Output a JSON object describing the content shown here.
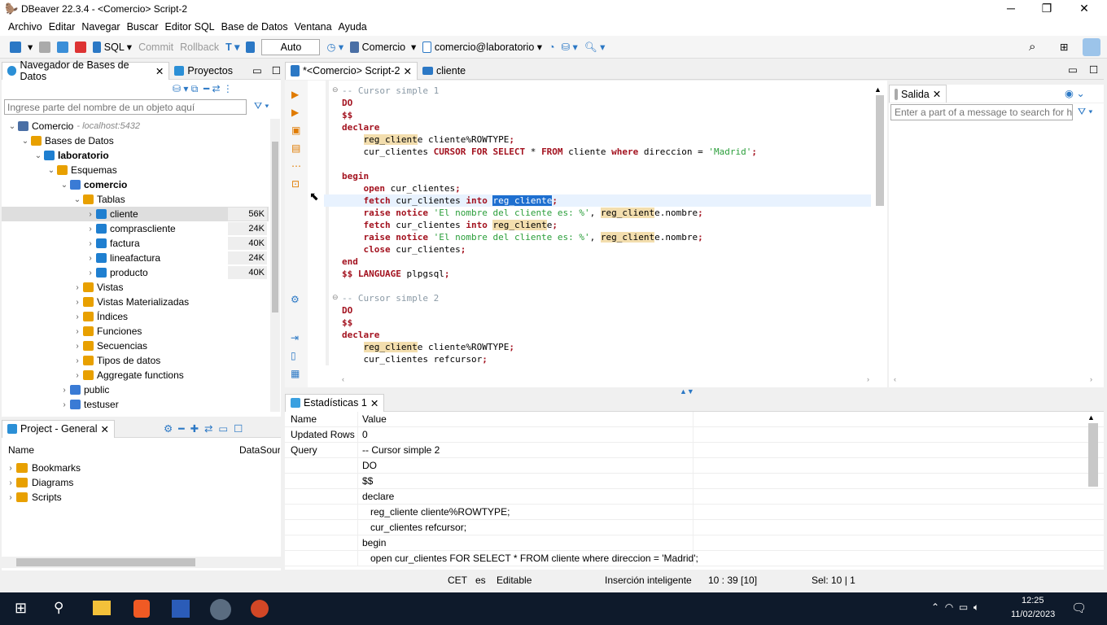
{
  "window": {
    "title": "DBeaver 22.3.4 - <Comercio> Script-2"
  },
  "menu": [
    "Archivo",
    "Editar",
    "Navegar",
    "Buscar",
    "Editor SQL",
    "Base de Datos",
    "Ventana",
    "Ayuda"
  ],
  "toolbar": {
    "sql": "SQL",
    "commit": "Commit",
    "rollback": "Rollback",
    "mode": "Auto",
    "datasource": "Comercio",
    "schema": "comercio@laboratorio"
  },
  "navigator": {
    "tab": "Navegador de Bases de Datos",
    "tab2": "Proyectos",
    "filter_placeholder": "Ingrese parte del nombre de un objeto aquí",
    "tree": [
      {
        "label": "Comercio",
        "extra": " - localhost:5432",
        "level": 0,
        "icon": "postgres",
        "color": "#4a6fa5"
      },
      {
        "label": "Bases de Datos",
        "level": 1,
        "icon": "folder",
        "color": "#e8a000"
      },
      {
        "label": "laboratorio",
        "level": 2,
        "icon": "database",
        "color": "#1f7fd0",
        "bold": true
      },
      {
        "label": "Esquemas",
        "level": 3,
        "icon": "folder",
        "color": "#e8a000"
      },
      {
        "label": "comercio",
        "level": 4,
        "icon": "schema",
        "color": "#3a7bd5",
        "bold": true
      },
      {
        "label": "Tablas",
        "level": 5,
        "icon": "folder",
        "color": "#e8a000"
      },
      {
        "label": "cliente",
        "level": 6,
        "icon": "table",
        "color": "#1f7fd0",
        "size": "56K",
        "selected": true
      },
      {
        "label": "comprascliente",
        "level": 6,
        "icon": "table",
        "color": "#1f7fd0",
        "size": "24K"
      },
      {
        "label": "factura",
        "level": 6,
        "icon": "table",
        "color": "#1f7fd0",
        "size": "40K"
      },
      {
        "label": "lineafactura",
        "level": 6,
        "icon": "table",
        "color": "#1f7fd0",
        "size": "24K"
      },
      {
        "label": "producto",
        "level": 6,
        "icon": "table",
        "color": "#1f7fd0",
        "size": "40K"
      },
      {
        "label": "Vistas",
        "level": 5,
        "icon": "folder",
        "color": "#e8a000"
      },
      {
        "label": "Vistas Materializadas",
        "level": 5,
        "icon": "folder",
        "color": "#e8a000"
      },
      {
        "label": "Índices",
        "level": 5,
        "icon": "folder",
        "color": "#e8a000"
      },
      {
        "label": "Funciones",
        "level": 5,
        "icon": "folder",
        "color": "#e8a000"
      },
      {
        "label": "Secuencias",
        "level": 5,
        "icon": "folder",
        "color": "#e8a000"
      },
      {
        "label": "Tipos de datos",
        "level": 5,
        "icon": "folder",
        "color": "#e8a000"
      },
      {
        "label": "Aggregate functions",
        "level": 5,
        "icon": "folder",
        "color": "#e8a000"
      },
      {
        "label": "public",
        "level": 4,
        "icon": "schema",
        "color": "#3a7bd5"
      },
      {
        "label": "testuser",
        "level": 4,
        "icon": "schema",
        "color": "#3a7bd5"
      }
    ]
  },
  "project": {
    "tab": "Project - General",
    "col_name": "Name",
    "col_ds": "DataSource",
    "items": [
      "Bookmarks",
      "Diagrams",
      "Scripts"
    ]
  },
  "editor": {
    "tab": "*<Comercio> Script-2",
    "tab2": "cliente",
    "lines": [
      [
        {
          "t": "-- Cursor simple 1",
          "c": "cm"
        }
      ],
      [
        {
          "t": "DO",
          "c": "kw"
        }
      ],
      [
        {
          "t": "$$",
          "c": "kw"
        }
      ],
      [
        {
          "t": "declare",
          "c": "kw"
        }
      ],
      [
        {
          "t": "    "
        },
        {
          "t": "reg_client",
          "c": "hl"
        },
        {
          "t": "e cliente%ROWTYPE"
        },
        {
          "t": ";",
          "c": "kw"
        }
      ],
      [
        {
          "t": "    cur_clientes "
        },
        {
          "t": "CURSOR FOR SELECT",
          "c": "kw"
        },
        {
          "t": " * "
        },
        {
          "t": "FROM",
          "c": "kw"
        },
        {
          "t": " cliente "
        },
        {
          "t": "where",
          "c": "kw"
        },
        {
          "t": " direccion = "
        },
        {
          "t": "'Madrid'",
          "c": "st"
        },
        {
          "t": ";",
          "c": "kw"
        }
      ],
      [],
      [
        {
          "t": "begin",
          "c": "kw"
        }
      ],
      [
        {
          "t": "    "
        },
        {
          "t": "open",
          "c": "kw"
        },
        {
          "t": " cur_clientes"
        },
        {
          "t": ";",
          "c": "kw"
        }
      ],
      [
        {
          "t": "    "
        },
        {
          "t": "fetch",
          "c": "kw"
        },
        {
          "t": " cur_clientes "
        },
        {
          "t": "into",
          "c": "kw"
        },
        {
          "t": " "
        },
        {
          "t": "reg_cliente",
          "c": "selx"
        },
        {
          "t": ";",
          "c": "kw"
        }
      ],
      [
        {
          "t": "    "
        },
        {
          "t": "raise notice",
          "c": "kw"
        },
        {
          "t": " "
        },
        {
          "t": "'El nombre del cliente es: %'",
          "c": "st"
        },
        {
          "t": ", "
        },
        {
          "t": "reg_client",
          "c": "hl"
        },
        {
          "t": "e.nombre"
        },
        {
          "t": ";",
          "c": "kw"
        }
      ],
      [
        {
          "t": "    "
        },
        {
          "t": "fetch",
          "c": "kw"
        },
        {
          "t": " cur_clientes "
        },
        {
          "t": "into",
          "c": "kw"
        },
        {
          "t": " "
        },
        {
          "t": "reg_client",
          "c": "hl"
        },
        {
          "t": "e"
        },
        {
          "t": ";",
          "c": "kw"
        }
      ],
      [
        {
          "t": "    "
        },
        {
          "t": "raise notice",
          "c": "kw"
        },
        {
          "t": " "
        },
        {
          "t": "'El nombre del cliente es: %'",
          "c": "st"
        },
        {
          "t": ", "
        },
        {
          "t": "reg_client",
          "c": "hl"
        },
        {
          "t": "e.nombre"
        },
        {
          "t": ";",
          "c": "kw"
        }
      ],
      [
        {
          "t": "    "
        },
        {
          "t": "close",
          "c": "kw"
        },
        {
          "t": " cur_clientes"
        },
        {
          "t": ";",
          "c": "kw"
        }
      ],
      [
        {
          "t": "end",
          "c": "kw"
        }
      ],
      [
        {
          "t": "$$ LANGUAGE",
          "c": "kw"
        },
        {
          "t": " plpgsql"
        },
        {
          "t": ";",
          "c": "kw"
        }
      ],
      [],
      [
        {
          "t": "-- Cursor simple 2",
          "c": "cm"
        }
      ],
      [
        {
          "t": "DO",
          "c": "kw"
        }
      ],
      [
        {
          "t": "$$",
          "c": "kw"
        }
      ],
      [
        {
          "t": "declare",
          "c": "kw"
        }
      ],
      [
        {
          "t": "    "
        },
        {
          "t": "reg_client",
          "c": "hl"
        },
        {
          "t": "e cliente%ROWTYPE"
        },
        {
          "t": ";",
          "c": "kw"
        }
      ],
      [
        {
          "t": "    cur_clientes refcursor"
        },
        {
          "t": ";",
          "c": "kw"
        }
      ]
    ]
  },
  "output": {
    "tab": "Salida",
    "search_placeholder": "Enter a part of a message to search for here"
  },
  "results": {
    "tab": "Estadísticas 1",
    "header": [
      "Name",
      "Value"
    ],
    "rows": [
      [
        "Updated Rows",
        "0"
      ],
      [
        "Query",
        "-- Cursor simple 2"
      ],
      [
        "",
        "DO"
      ],
      [
        "",
        "$$"
      ],
      [
        "",
        "declare"
      ],
      [
        "",
        "   reg_cliente cliente%ROWTYPE;"
      ],
      [
        "",
        "   cur_clientes refcursor;"
      ],
      [
        "",
        "begin"
      ],
      [
        "",
        "   open cur_clientes FOR SELECT * FROM cliente where direccion = 'Madrid';"
      ]
    ]
  },
  "status": {
    "tz": "CET",
    "lang": "es",
    "mode": "Editable",
    "insert": "Inserción inteligente",
    "pos": "10 : 39 [10]",
    "sel": "Sel: 10 | 1"
  },
  "taskbar": {
    "time": "12:25",
    "date": "11/02/2023"
  }
}
